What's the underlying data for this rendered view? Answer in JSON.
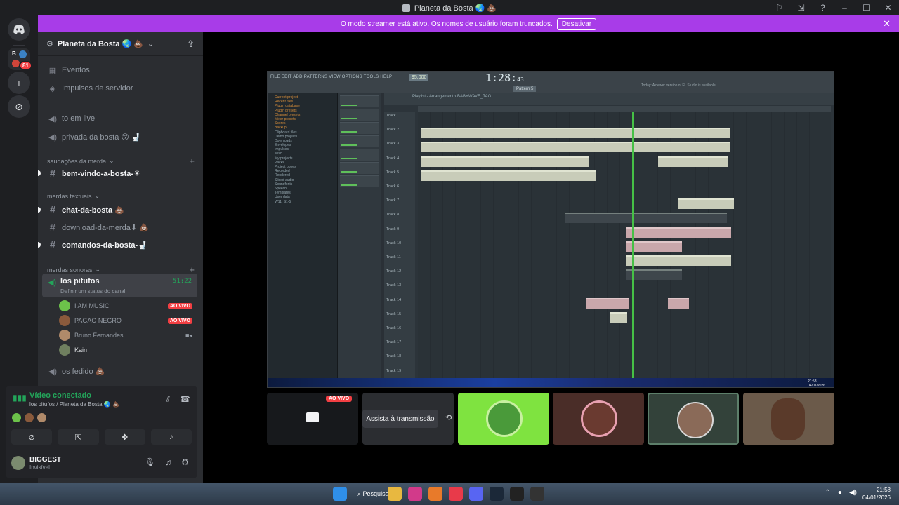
{
  "window": {
    "title": "Planeta da Bosta 🌏 💩",
    "controls": [
      "⚐",
      "⇲",
      "?",
      "–",
      "☐",
      "✕"
    ]
  },
  "banner": {
    "text": "O modo streamer está ativo. Os nomes de usuário foram truncados.",
    "button": "Desativar",
    "close": "✕"
  },
  "guilds": {
    "folder_badge": "81",
    "folder_letter": "B"
  },
  "server": {
    "name": "Planeta da Bosta 🌏 💩"
  },
  "channels": {
    "events": "Eventos",
    "boosts": "Impulsos de servidor",
    "to_em_live": "to em live",
    "privada": "privada da bosta 😚 🚽",
    "cat1": "saudações da merda",
    "bem_vindo": "bem-vindo-a-bosta-☀",
    "cat2": "merdas textuais",
    "chat": "chat-da-bosta 💩",
    "download": "download-da-merda⬇ 💩",
    "comandos": "comandos-da-bosta-🚽",
    "cat3": "merdas sonoras",
    "voice": {
      "name": "los pitufos",
      "time": "51:22",
      "status": "Definir um status do canal"
    },
    "fedido": "os fedido 💩"
  },
  "members": [
    {
      "name": "I AM MUSIC",
      "badge": "AO VIVO",
      "color": "#6cc24a"
    },
    {
      "name": "PAGAO NEGRO",
      "badge": "AO VIVO",
      "color": "#8a5a3c"
    },
    {
      "name": "Bruno Fernandes",
      "badge": "",
      "color": "#b08a6a"
    },
    {
      "name": "Kain",
      "badge": "",
      "color": "#6f7f5f"
    }
  ],
  "voice_panel": {
    "title": "Vídeo conectado",
    "subtitle": "los pitufos / Planeta da Bosta 🌏 💩"
  },
  "user": {
    "name": "BIGGEST",
    "status": "Invisível"
  },
  "fl": {
    "menu": "FILE EDIT ADD PATTERNS VIEW OPTIONS TOOLS HELP",
    "bpm": "95.000",
    "time": "1:28:",
    "time_small": "43",
    "pattern": "Pattern 5",
    "hint": "Today: A newer version of FL Studio is available!",
    "playlist_title": "Playlist - Arrangement › BABYWAVE_TAG",
    "browser_items": [
      "Current project",
      "Recent files",
      "Plugin database",
      "Plugin presets",
      "Channel presets",
      "Mixer presets",
      "Scores",
      "Backup",
      "Clipboard files",
      "Demo projects",
      "Downloads",
      "Envelopes",
      "Impulses",
      "Misc",
      "My projects",
      "Packs",
      "Project bones",
      "Recorded",
      "Rendered",
      "Sliced audio",
      "Soundfonts",
      "Speech",
      "Templates",
      "User data",
      "W11_S1-5"
    ],
    "tracks": [
      "Track 1",
      "Track 2",
      "Track 3",
      "Track 4",
      "Track 5",
      "Track 6",
      "Track 7",
      "Track 8",
      "Track 9",
      "Track 10",
      "Track 11",
      "Track 12",
      "Track 13",
      "Track 14",
      "Track 15",
      "Track 16",
      "Track 17",
      "Track 18",
      "Track 19"
    ],
    "taskbar_time": "21:58",
    "taskbar_date": "04/01/2026"
  },
  "tiles": {
    "live": "AO VIVO",
    "watch": "Assista à transmissão"
  },
  "taskbar": {
    "search": "Pesquisar",
    "time": "21:58",
    "date": "04/01/2026"
  }
}
